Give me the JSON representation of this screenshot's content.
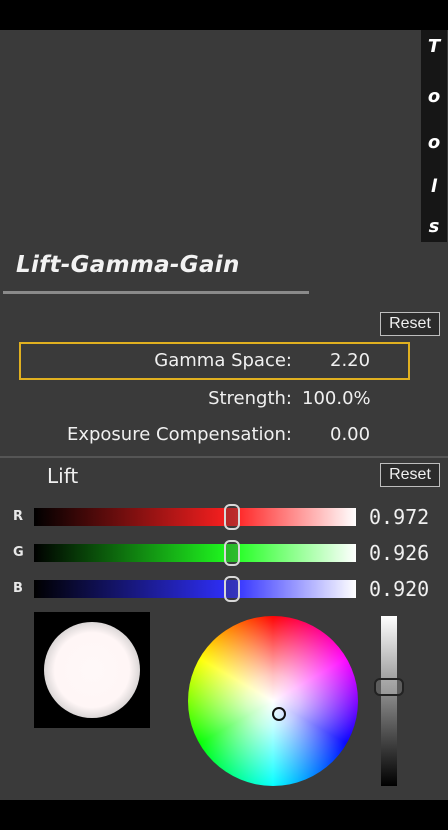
{
  "tools_tab": {
    "letters": [
      "T",
      "o",
      "o",
      "l",
      "s"
    ]
  },
  "section": {
    "title": "Lift-Gamma-Gain",
    "reset_label": "Reset"
  },
  "params": [
    {
      "label": "Gamma Space:",
      "value": "2.20",
      "highlighted": true
    },
    {
      "label": "Strength:",
      "value": "100.0%"
    },
    {
      "label": "Exposure Compensation:",
      "value": "0.00"
    }
  ],
  "lift": {
    "label": "Lift",
    "reset_label": "Reset",
    "channels": [
      {
        "name": "R",
        "value": "0.972",
        "level": 0.62,
        "color": "#ff2020"
      },
      {
        "name": "G",
        "value": "0.926",
        "level": 0.62,
        "color": "#20ff20"
      },
      {
        "name": "B",
        "value": "0.920",
        "level": 0.62,
        "color": "#3030ff"
      }
    ],
    "wheel_cursor": {
      "hue_deg": 110,
      "saturation": 0.3
    },
    "brightness_level": 0.58,
    "highlight_color": "#e0b020"
  }
}
